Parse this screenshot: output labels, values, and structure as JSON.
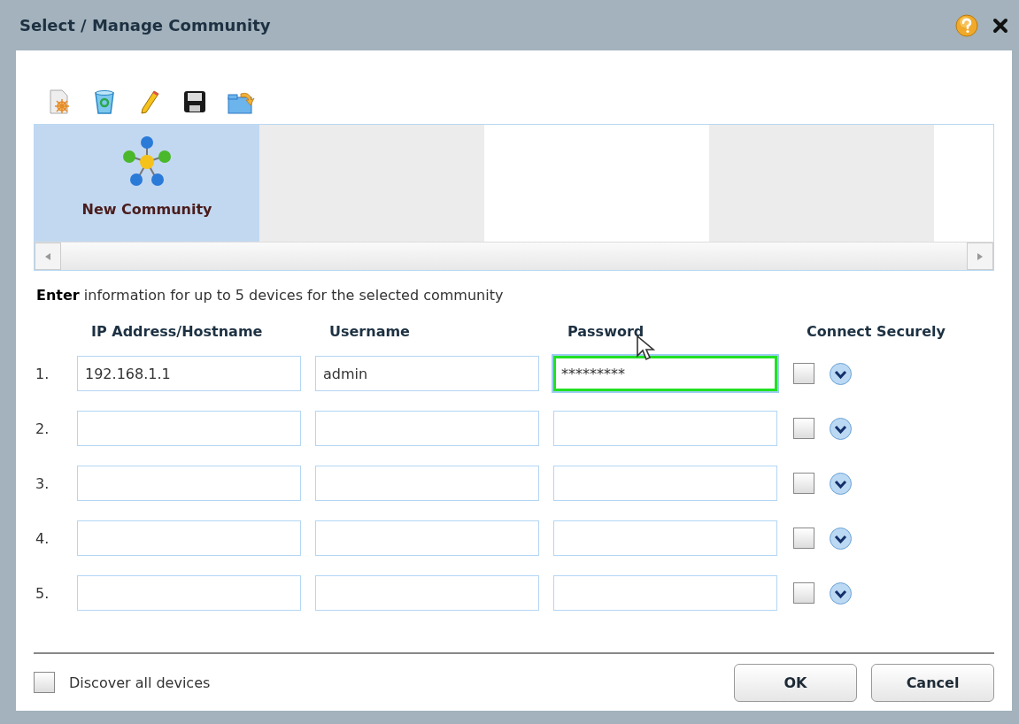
{
  "window": {
    "title": "Select / Manage Community"
  },
  "tiles": [
    {
      "label": "New Community",
      "selected": true
    }
  ],
  "instruction": "**Enter** information for up to 5 devices for the selected community",
  "columns": [
    "IP Address/Hostname",
    "Username",
    "Password",
    "Connect Securely"
  ],
  "rows": [
    {
      "number": "1.",
      "host": {
        "value": "192.168.1.1",
        "focused": false
      },
      "username": {
        "value": "admin",
        "focused": false
      },
      "password": {
        "value": "*********",
        "focused": true
      },
      "secure": false
    },
    {
      "number": "2.",
      "host": {
        "focused": false
      },
      "username": {
        "focused": false
      },
      "password": {
        "focused": false
      },
      "secure": false
    },
    {
      "number": "3.",
      "host": {
        "focused": false
      },
      "username": {
        "focused": false
      },
      "password": {
        "focused": false
      },
      "secure": false
    },
    {
      "number": "4.",
      "host": {
        "focused": false
      },
      "username": {
        "focused": false
      },
      "password": {
        "focused": false
      },
      "secure": false
    },
    {
      "number": "5.",
      "host": {
        "focused": false
      },
      "username": {
        "focused": false
      },
      "password": {
        "focused": false
      },
      "secure": false
    }
  ],
  "discover": {
    "label": "Discover all devices",
    "checked": false
  },
  "buttons": [
    "OK",
    "Cancel"
  ]
}
